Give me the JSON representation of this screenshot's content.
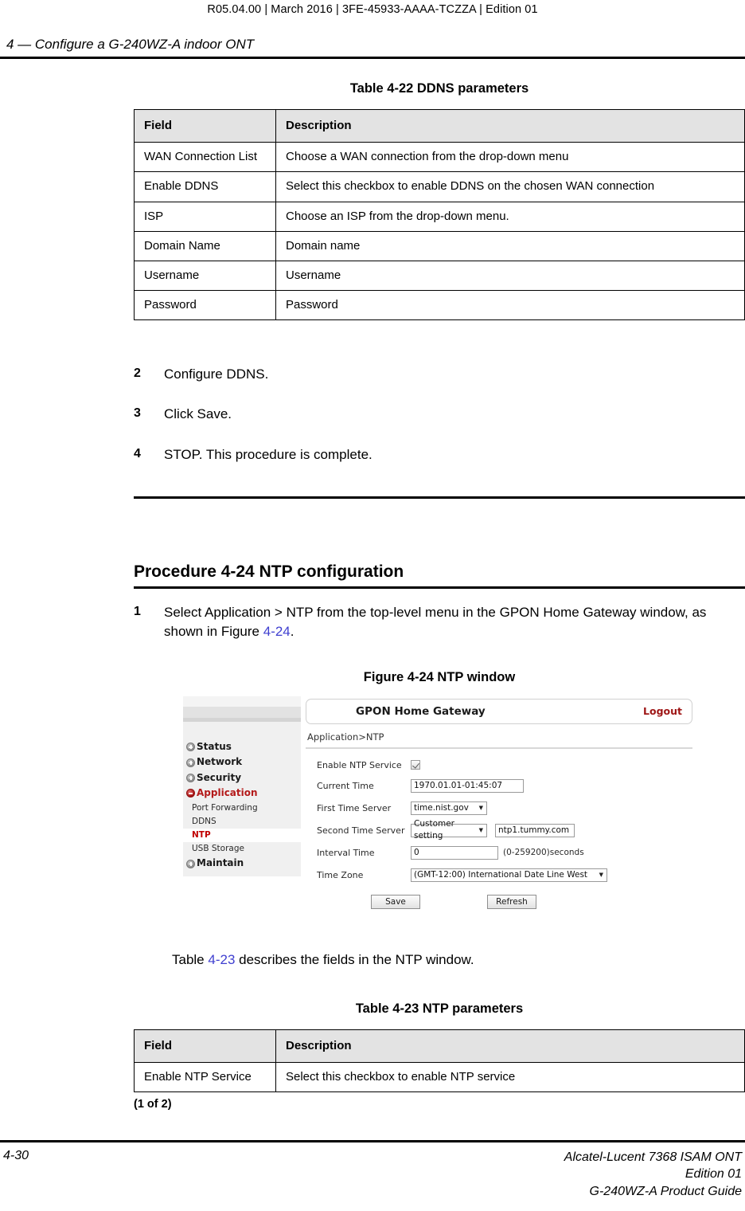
{
  "header": {
    "meta_line": "R05.04.00 | March 2016 | 3FE-45933-AAAA-TCZZA | Edition 01",
    "chapter": "4 —  Configure a G-240WZ-A indoor ONT"
  },
  "table_ddns": {
    "caption": "Table 4-22 DDNS parameters",
    "columns": [
      "Field",
      "Description"
    ],
    "rows": [
      {
        "field": "WAN Connection List",
        "description": "Choose a WAN connection from the drop-down menu"
      },
      {
        "field": "Enable DDNS",
        "description": "Select this checkbox to enable DDNS on the chosen WAN connection"
      },
      {
        "field": "ISP",
        "description": "Choose an ISP from the drop-down menu."
      },
      {
        "field": "Domain Name",
        "description": "Domain name"
      },
      {
        "field": "Username",
        "description": "Username"
      },
      {
        "field": "Password",
        "description": "Password"
      }
    ]
  },
  "steps_ddns": [
    {
      "num": "2",
      "text": "Configure DDNS."
    },
    {
      "num": "3",
      "text": "Click Save."
    },
    {
      "num": "4",
      "text": "STOP. This procedure is complete."
    }
  ],
  "procedure": {
    "title": "Procedure 4-24  NTP configuration",
    "step1_num": "1",
    "step1_text_a": "Select Application > NTP from the top-level menu in the GPON Home Gateway window, as shown in Figure ",
    "step1_link": "4-24",
    "step1_text_b": "."
  },
  "figure": {
    "caption": "Figure 4-24  NTP window",
    "gui": {
      "title": "GPON Home Gateway",
      "logout": "Logout",
      "breadcrumb": "Application>NTP",
      "sidebar": [
        {
          "label": "Status",
          "icon": "plus-icon",
          "type": "top"
        },
        {
          "label": "Network",
          "icon": "plus-icon",
          "type": "top"
        },
        {
          "label": "Security",
          "icon": "plus-icon",
          "type": "top"
        },
        {
          "label": "Application",
          "icon": "minus-icon",
          "type": "top-active"
        },
        {
          "label": "Port Forwarding",
          "icon": "none",
          "type": "sub"
        },
        {
          "label": "DDNS",
          "icon": "none",
          "type": "sub"
        },
        {
          "label": "NTP",
          "icon": "none",
          "type": "sub-active"
        },
        {
          "label": "USB Storage",
          "icon": "none",
          "type": "sub"
        },
        {
          "label": "Maintain",
          "icon": "plus-icon",
          "type": "top"
        }
      ],
      "fields": {
        "enable_ntp_label": "Enable NTP Service",
        "enable_ntp_checked": true,
        "current_time_label": "Current Time",
        "current_time_value": "1970.01.01-01:45:07",
        "first_server_label": "First Time Server",
        "first_server_value": "time.nist.gov",
        "second_server_label": "Second Time Server",
        "second_server_value": "Customer setting",
        "second_server_custom": "ntp1.tummy.com",
        "interval_label": "Interval Time",
        "interval_value": "0",
        "interval_suffix": "(0-259200)seconds",
        "timezone_label": "Time Zone",
        "timezone_value": "(GMT-12:00) International Date Line West"
      },
      "buttons": {
        "save": "Save",
        "refresh": "Refresh"
      }
    }
  },
  "intro_ntp": {
    "text_a": "Table ",
    "link": "4-23",
    "text_b": " describes the fields in the NTP window."
  },
  "table_ntp": {
    "caption": "Table 4-23 NTP parameters",
    "columns": [
      "Field",
      "Description"
    ],
    "rows": [
      {
        "field": "Enable NTP Service",
        "description": "Select this checkbox to enable NTP service"
      }
    ],
    "continuation": "(1 of 2)"
  },
  "footer": {
    "page": "4-30",
    "line1": "Alcatel-Lucent 7368 ISAM ONT",
    "line2": "Edition 01",
    "line3": "G-240WZ-A Product Guide"
  }
}
